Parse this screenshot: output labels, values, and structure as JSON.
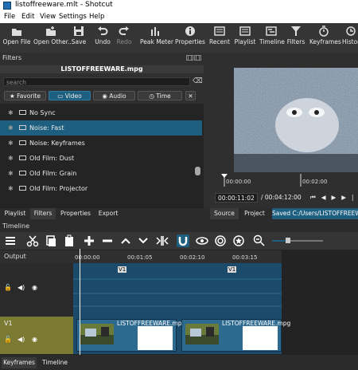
{
  "window": {
    "title": "listoffreeware.mlt - Shotcut"
  },
  "menu": [
    "File",
    "Edit",
    "View",
    "Settings",
    "Help"
  ],
  "toolbar": [
    {
      "label": "Open File",
      "icon": "open-file-icon"
    },
    {
      "label": "Open Other...",
      "icon": "open-other-icon"
    },
    {
      "label": "Save",
      "icon": "save-icon"
    },
    {
      "label": "Undo",
      "icon": "undo-icon"
    },
    {
      "label": "Redo",
      "icon": "redo-icon",
      "disabled": true
    },
    {
      "label": "Peak Meter",
      "icon": "peak-meter-icon"
    },
    {
      "label": "Properties",
      "icon": "properties-icon"
    },
    {
      "label": "Recent",
      "icon": "recent-icon"
    },
    {
      "label": "Playlist",
      "icon": "playlist-icon"
    },
    {
      "label": "Timeline",
      "icon": "timeline-icon"
    },
    {
      "label": "Filters",
      "icon": "filters-icon"
    },
    {
      "label": "Keyframes",
      "icon": "keyframes-icon"
    },
    {
      "label": "Histor",
      "icon": "history-icon"
    }
  ],
  "filters": {
    "header": "Filters",
    "clip_name": "LISTOFFREEWARE.mpg",
    "search_placeholder": "search",
    "tabs": [
      "Favorite",
      "Video",
      "Audio",
      "Time"
    ],
    "active_tab": "Video",
    "items": [
      "No Sync",
      "Noise: Fast",
      "Noise: Keyframes",
      "Old Film: Dust",
      "Old Film: Grain",
      "Old Film: Projector"
    ],
    "selected_item": "Noise: Fast"
  },
  "player": {
    "ruler_ticks": [
      "00:00:00",
      "00:02:00"
    ],
    "current_time": "00:00:11:02",
    "total_time": "/ 00:04:12:00"
  },
  "left_tabs": [
    "Playlist",
    "Filters",
    "Properties",
    "Export"
  ],
  "right_tabs": [
    "Source",
    "Project",
    "Saved C:/Users/LISTOFFREEWA"
  ],
  "timeline": {
    "header": "Timeline",
    "output_label": "Output",
    "ruler": [
      "00:00:00",
      "00:01:05",
      "00:02:10",
      "00:03:15"
    ],
    "track_labels": [
      "V1"
    ],
    "clip_name": "LISTOFFREEWARE.mpg",
    "markers": [
      "V1",
      "V1"
    ]
  },
  "bottom_tabs": [
    "Keyframes",
    "Timeline"
  ],
  "colors": {
    "accent": "#1e5f80",
    "track_blue": "#1b4a6a",
    "v1_header": "#7a7a32"
  }
}
